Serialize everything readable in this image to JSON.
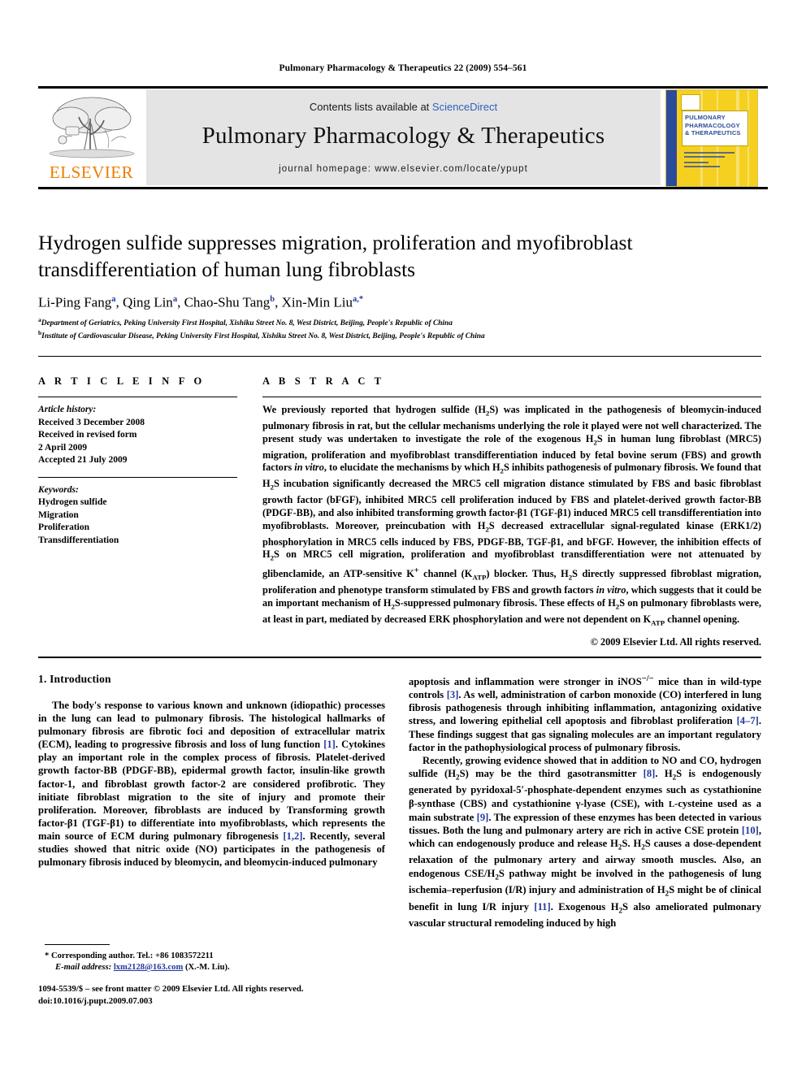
{
  "running_head": "Pulmonary Pharmacology & Therapeutics 22 (2009) 554–561",
  "masthead": {
    "contents_prefix": "Contents lists available at ",
    "sciencedirect": "ScienceDirect",
    "journal_title": "Pulmonary Pharmacology & Therapeutics",
    "homepage": "journal homepage: www.elsevier.com/locate/ypupt",
    "publisher_wordmark": "ELSEVIER",
    "publisher_accent_color": "#ee7d00",
    "link_color": "#2f5fbd",
    "cover": {
      "line1": "PULMONARY",
      "line2": "PHARMACOLOGY",
      "line3": "& THERAPEUTICS",
      "background_color": "#f5d020",
      "bar_color": "#2b4c9b"
    }
  },
  "article": {
    "title": "Hydrogen sulfide suppresses migration, proliferation and myofibroblast transdifferentiation of human lung fibroblasts",
    "authors": [
      {
        "name": "Li-Ping Fang",
        "marks": "a"
      },
      {
        "name": "Qing Lin",
        "marks": "a"
      },
      {
        "name": "Chao-Shu Tang",
        "marks": "b"
      },
      {
        "name": "Xin-Min Liu",
        "marks": "a,*"
      }
    ],
    "affiliations": [
      {
        "mark": "a",
        "text": "Department of Geriatrics, Peking University First Hospital, Xishiku Street No. 8, West District, Beijing, People's Republic of China"
      },
      {
        "mark": "b",
        "text": "Institute of Cardiovascular Disease, Peking University First Hospital, Xishiku Street No. 8, West District, Beijing, People's Republic of China"
      }
    ]
  },
  "article_info": {
    "heading": "A R T I C L E   I N F O",
    "history_label": "Article history:",
    "history": [
      "Received 3 December 2008",
      "Received in revised form",
      "2 April 2009",
      "Accepted 21 July 2009"
    ],
    "keywords_label": "Keywords:",
    "keywords": [
      "Hydrogen sulfide",
      "Migration",
      "Proliferation",
      "Transdifferentiation"
    ]
  },
  "abstract": {
    "heading": "A B S T R A C T",
    "copyright": "© 2009 Elsevier Ltd. All rights reserved."
  },
  "introduction": {
    "heading": "1. Introduction"
  },
  "footnotes": {
    "corresponding": "* Corresponding author. Tel.: +86 1083572211",
    "email_label": "E-mail address:",
    "email": "lxm2128@163.com",
    "email_owner": "(X.-M. Liu)."
  },
  "imprint": {
    "line1": "1094-5539/$ – see front matter © 2009 Elsevier Ltd. All rights reserved.",
    "line2": "doi:10.1016/j.pupt.2009.07.003"
  }
}
